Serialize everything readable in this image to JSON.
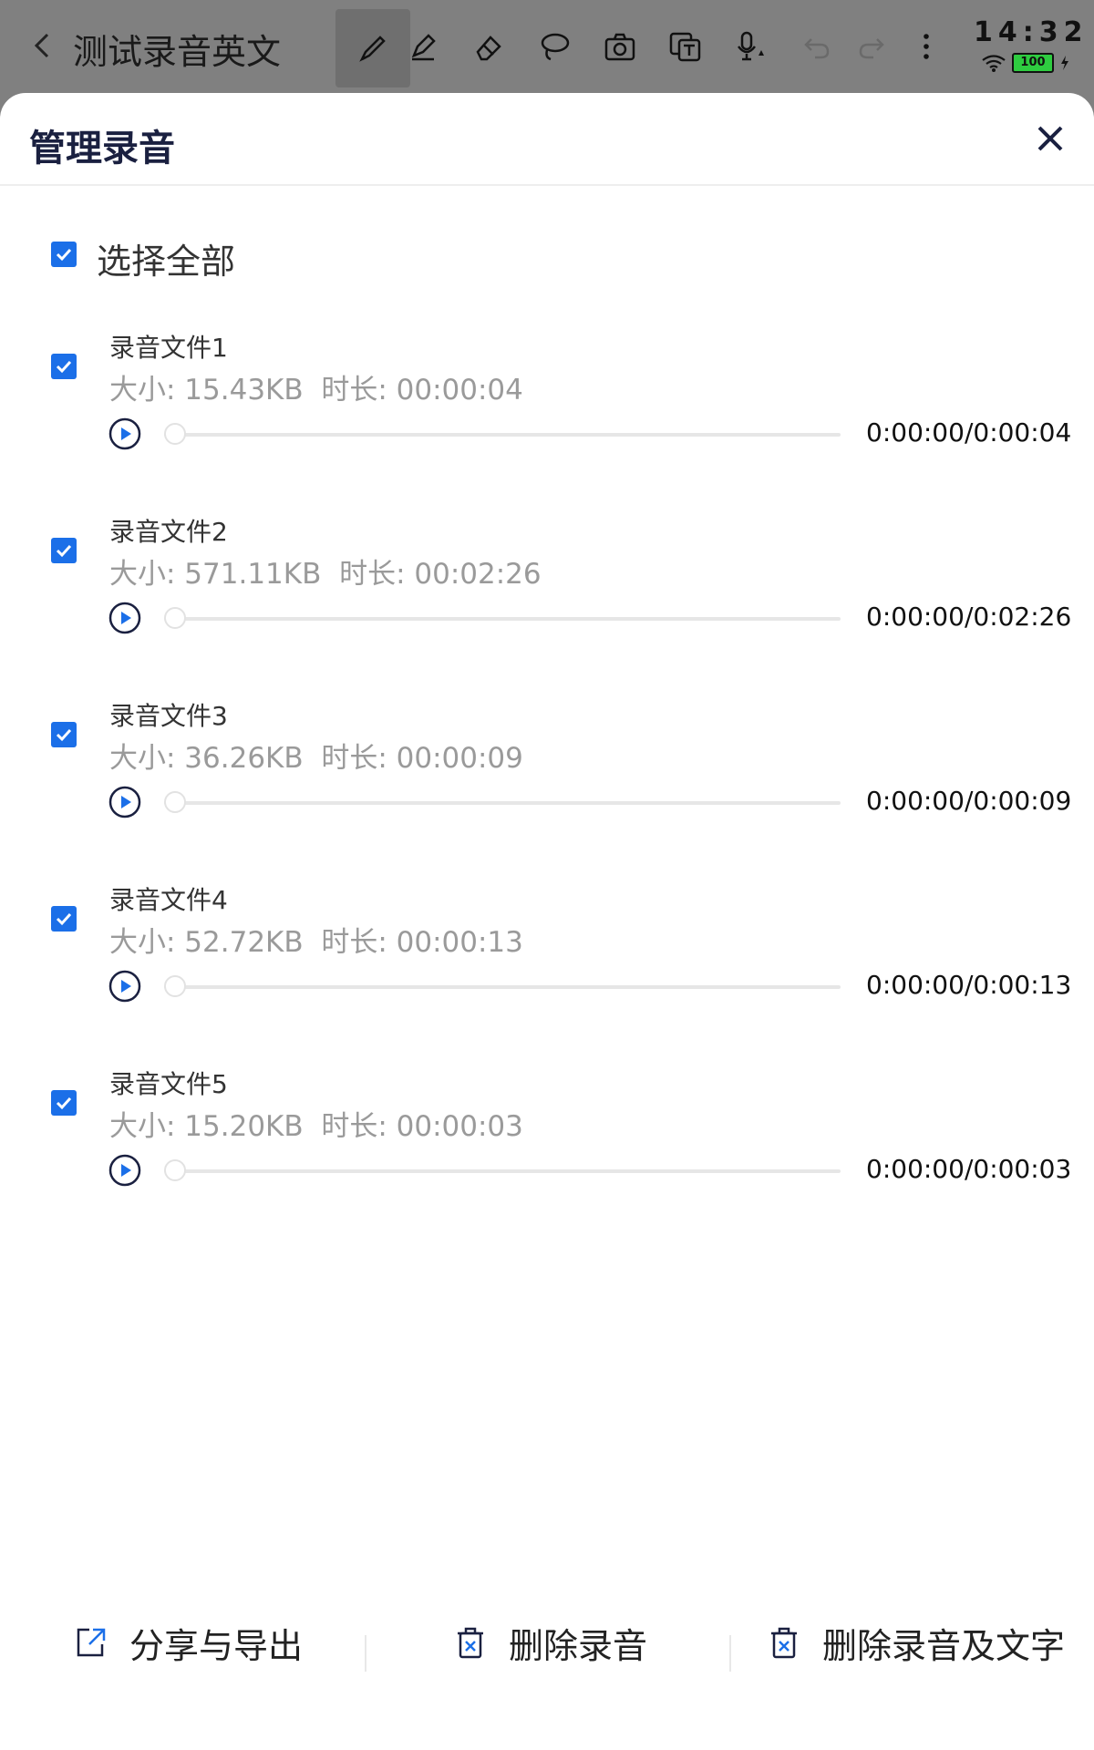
{
  "topbar": {
    "title": "测试录音英文",
    "clock": "14:32",
    "battery": "100",
    "tools": [
      "pen-icon",
      "highlighter-icon",
      "eraser-icon",
      "lasso-icon",
      "camera-icon",
      "text-recognize-icon",
      "mic-record-icon",
      "undo-icon",
      "redo-icon",
      "more-icon"
    ]
  },
  "dialog": {
    "title": "管理录音",
    "select_all_label": "选择全部",
    "select_all_checked": true
  },
  "recordings": [
    {
      "name": "录音文件1",
      "meta": "大小: 15.43KB  时长: 00:00:04",
      "time": "0:00:00/0:00:04",
      "checked": true,
      "progress": 0
    },
    {
      "name": "录音文件2",
      "meta": "大小: 571.11KB  时长: 00:02:26",
      "time": "0:00:00/0:02:26",
      "checked": true,
      "progress": 0
    },
    {
      "name": "录音文件3",
      "meta": "大小: 36.26KB  时长: 00:00:09",
      "time": "0:00:00/0:00:09",
      "checked": true,
      "progress": 0
    },
    {
      "name": "录音文件4",
      "meta": "大小: 52.72KB  时长: 00:00:13",
      "time": "0:00:00/0:00:13",
      "checked": true,
      "progress": 0
    },
    {
      "name": "录音文件5",
      "meta": "大小: 15.20KB  时长: 00:00:03",
      "time": "0:00:00/0:00:03",
      "checked": true,
      "progress": 0
    }
  ],
  "actions": {
    "share_label": "分享与导出",
    "delete_recording_label": "删除录音",
    "delete_recording_text_label": "删除录音及文字"
  },
  "colors": {
    "accent": "#1b6fe8",
    "title_dark": "#1a2040",
    "meta_gray": "#9a9a9a"
  }
}
